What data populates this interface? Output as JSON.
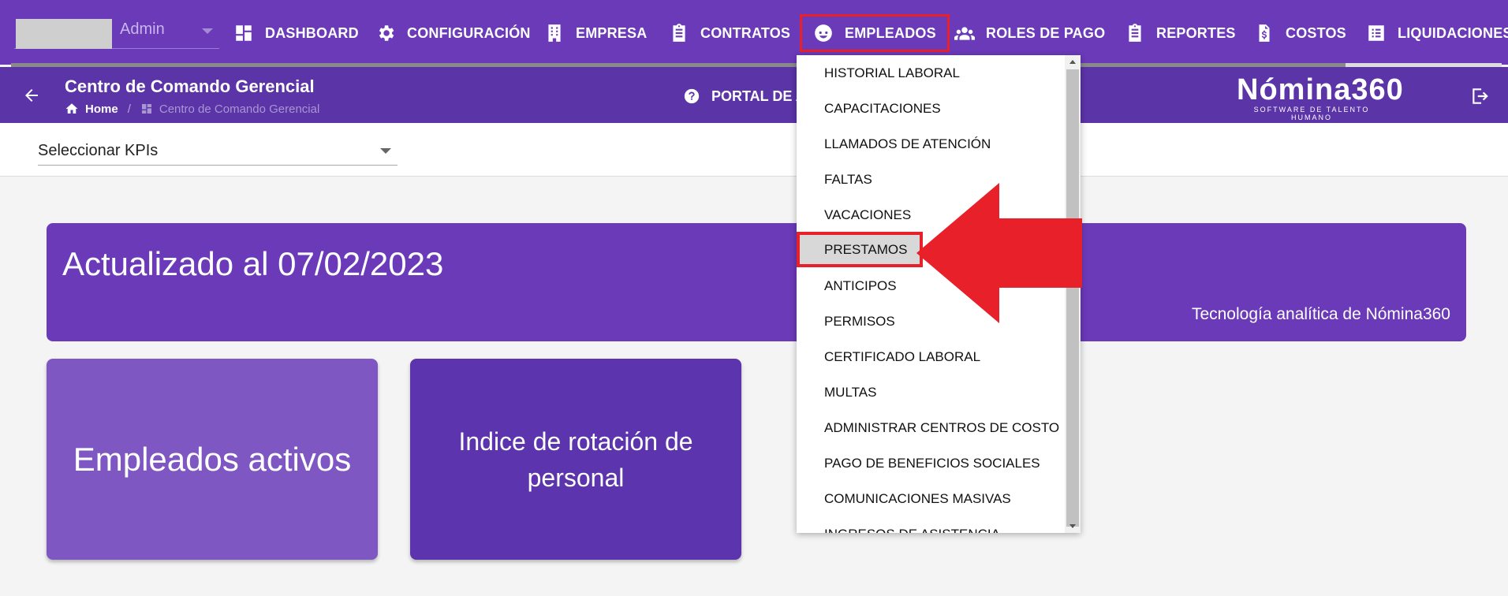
{
  "user": {
    "name": "Admin"
  },
  "nav": [
    {
      "label": "DASHBOARD",
      "icon": "dashboard-icon"
    },
    {
      "label": "CONFIGURACIÓN",
      "icon": "gear-icon"
    },
    {
      "label": "EMPRESA",
      "icon": "building-icon"
    },
    {
      "label": "CONTRATOS",
      "icon": "clipboard-icon"
    },
    {
      "label": "EMPLEADOS",
      "icon": "face-icon"
    },
    {
      "label": "ROLES DE PAGO",
      "icon": "group-icon"
    },
    {
      "label": "REPORTES",
      "icon": "clipboard-icon"
    },
    {
      "label": "COSTOS",
      "icon": "invoice-icon"
    },
    {
      "label": "LIQUIDACIONES",
      "icon": "list-icon"
    }
  ],
  "subheader": {
    "title": "Centro de Comando Gerencial",
    "breadcrumb_home": "Home",
    "breadcrumb_current": "Centro de Comando Gerencial",
    "portal": "PORTAL DE A",
    "brand_name": "Nómina360",
    "brand_tag": "SOFTWARE DE TALENTO HUMANO"
  },
  "kpi": {
    "value": "Seleccionar KPIs"
  },
  "banner": {
    "title": "Actualizado al 07/02/2023",
    "subtitle": "Tecnología analítica de Nómina360"
  },
  "cards": [
    "Empleados activos",
    "Indice de rotación de personal"
  ],
  "dropdown": {
    "items": [
      "HISTORIAL LABORAL",
      "CAPACITACIONES",
      "LLAMADOS DE ATENCIÓN",
      "FALTAS",
      "VACACIONES",
      "PRESTAMOS",
      "ANTICIPOS",
      "PERMISOS",
      "CERTIFICADO LABORAL",
      "MULTAS",
      "ADMINISTRAR CENTROS DE COSTO",
      "PAGO DE BENEFICIOS SOCIALES",
      "COMUNICACIONES MASIVAS",
      "INGRESOS DE ASISTENCIA"
    ],
    "selected": "PRESTAMOS"
  },
  "colors": {
    "primary": "#6a3ab8",
    "subheader": "#5b34a8",
    "highlight": "#e8202a"
  }
}
